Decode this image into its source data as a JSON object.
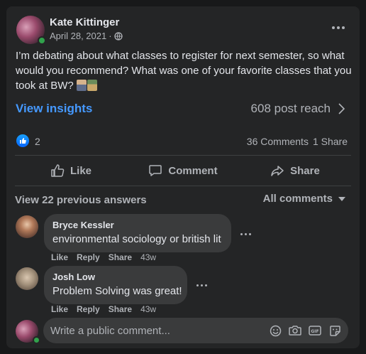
{
  "post": {
    "author": "Kate Kittinger",
    "date": "April 28, 2021",
    "separator": "·",
    "audience_icon": "globe-icon",
    "text": "I’m debating about what classes to register for next semester, so what would you recommend? What was one of your favorite classes that you took at BW?",
    "emojis": [
      "student-emoji",
      "teacher-emoji"
    ]
  },
  "insights": {
    "link": "View insights",
    "reach": "608 post reach"
  },
  "stats": {
    "reaction_icon": "like-icon",
    "reaction_count": "2",
    "comments": "36 Comments",
    "shares": "1 Share"
  },
  "actions": {
    "like": "Like",
    "comment": "Comment",
    "share": "Share"
  },
  "comments_section": {
    "previous": "View 22 previous answers",
    "filter": "All comments"
  },
  "comments": [
    {
      "name": "Bryce Kessler",
      "text": "environmental sociology or british lit",
      "like": "Like",
      "reply": "Reply",
      "share": "Share",
      "time": "43w"
    },
    {
      "name": "Josh Low",
      "text": "Problem Solving was great!",
      "like": "Like",
      "reply": "Reply",
      "share": "Share",
      "time": "43w"
    }
  ],
  "composer": {
    "placeholder": "Write a public comment...",
    "tools": [
      "emoji-icon",
      "camera-icon",
      "gif-icon",
      "sticker-icon"
    ]
  },
  "colors": {
    "background": "#18191a",
    "card": "#242526",
    "bubble": "#3a3b3c",
    "link_blue": "#4599ff",
    "online_green": "#31a24c",
    "text_primary": "#e4e6eb",
    "text_secondary": "#b0b3b8"
  }
}
